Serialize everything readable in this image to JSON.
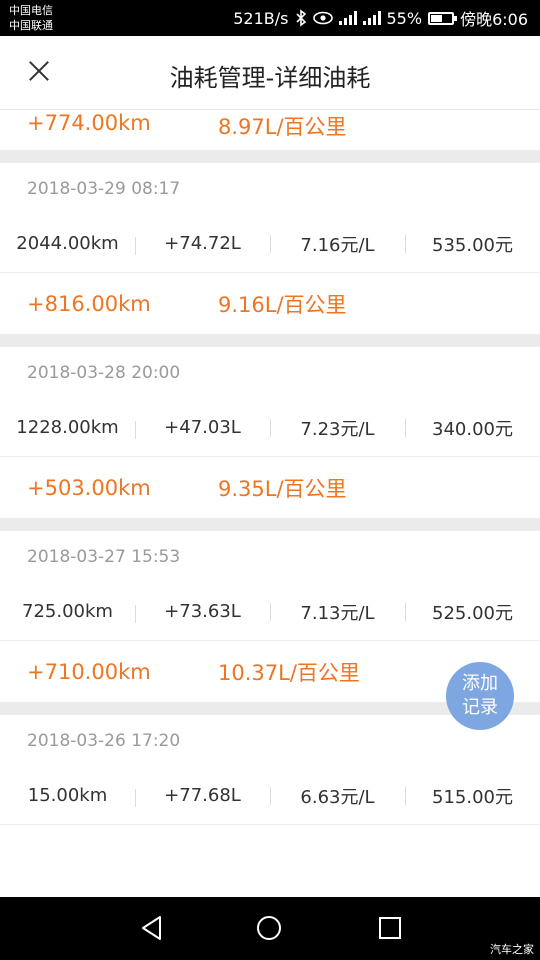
{
  "status_bar": {
    "carrier1": "中国电信",
    "carrier2": "中国联通",
    "net_speed": "521B/s",
    "battery_text": "55%",
    "battery_level": 0.55,
    "time": "傍晚6:06"
  },
  "header": {
    "title": "油耗管理-详细油耗"
  },
  "top_summary": {
    "distance": "+774.00km",
    "efficiency": "8.97L/百公里"
  },
  "records": [
    {
      "date": "2018-03-29 08:17",
      "odometer": "2044.00km",
      "fuel": "+74.72L",
      "price": "7.16元/L",
      "amount": "535.00元",
      "distance": "+816.00km",
      "efficiency": "9.16L/百公里"
    },
    {
      "date": "2018-03-28 20:00",
      "odometer": "1228.00km",
      "fuel": "+47.03L",
      "price": "7.23元/L",
      "amount": "340.00元",
      "distance": "+503.00km",
      "efficiency": "9.35L/百公里"
    },
    {
      "date": "2018-03-27 15:53",
      "odometer": "725.00km",
      "fuel": "+73.63L",
      "price": "7.13元/L",
      "amount": "525.00元",
      "distance": "+710.00km",
      "efficiency": "10.37L/百公里"
    },
    {
      "date": "2018-03-26 17:20",
      "odometer": "15.00km",
      "fuel": "+77.68L",
      "price": "6.63元/L",
      "amount": "515.00元"
    }
  ],
  "add_button": {
    "line1": "添加",
    "line2": "记录"
  },
  "watermark": "汽车之家",
  "colors": {
    "accent_orange": "#ee7521",
    "fab_blue": "#7ea6e0",
    "date_gray": "#9a9a9a"
  },
  "icons": {
    "close": "close-icon",
    "bluetooth": "bluetooth-icon",
    "eye": "eye-comfort-icon",
    "signal": "signal-icon",
    "battery": "battery-icon",
    "back": "back-triangle-icon",
    "home": "home-circle-icon",
    "recent": "recent-apps-icon"
  }
}
